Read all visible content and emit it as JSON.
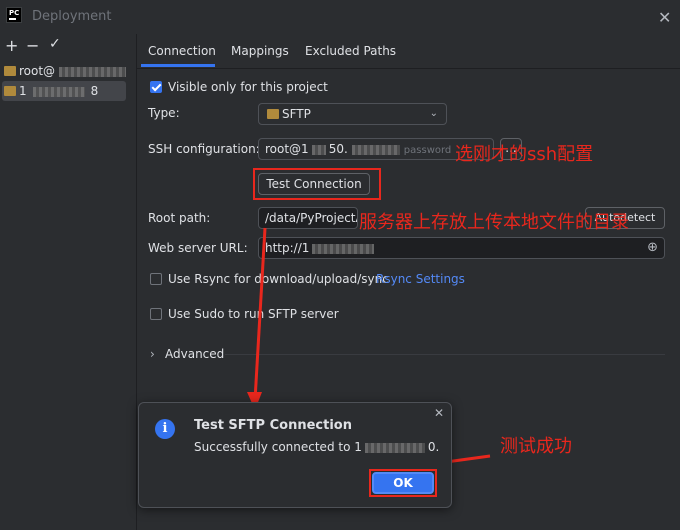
{
  "window": {
    "title": "Deployment",
    "logo_text": "PC"
  },
  "left_panel": {
    "toolbar": {
      "add": "+",
      "remove": "−",
      "check": "✓"
    },
    "servers": [
      {
        "label": "root@",
        "selected": false
      },
      {
        "label": "1",
        "suffix": "8",
        "selected": true
      }
    ]
  },
  "tabs": [
    {
      "label": "Connection",
      "active": true
    },
    {
      "label": "Mappings",
      "active": false
    },
    {
      "label": "Excluded Paths",
      "active": false
    }
  ],
  "form": {
    "visible_only_label": "Visible only for this project",
    "visible_only_checked": true,
    "type_label": "Type:",
    "type_value": "SFTP",
    "ssh_label": "SSH configuration:",
    "ssh_value_prefix": "root@1",
    "ssh_value_mid": "50.",
    "ssh_value_suffix": "password",
    "ssh_more": "...",
    "test_connection": "Test Connection",
    "root_path_label": "Root path:",
    "root_path_value": "/data/PyProjectAI",
    "autodetect": "Autodetect",
    "web_url_label": "Web server URL:",
    "web_url_value": "http://1",
    "rsync_label": "Use Rsync for download/upload/sync",
    "rsync_checked": false,
    "rsync_settings": "Rsync Settings",
    "sudo_label": "Use Sudo to run SFTP server",
    "sudo_checked": false,
    "advanced": "Advanced"
  },
  "dialog": {
    "title": "Test SFTP Connection",
    "message_prefix": "Successfully connected to 1",
    "message_suffix": "0.",
    "ok": "OK"
  },
  "annotations": {
    "ssh_note": "选刚才的ssh配置",
    "path_note": "服务器上存放上传本地文件的目录",
    "success_note": "测试成功"
  },
  "colors": {
    "accent": "#3574f0",
    "annotation": "#e8271d",
    "link": "#548af7"
  }
}
